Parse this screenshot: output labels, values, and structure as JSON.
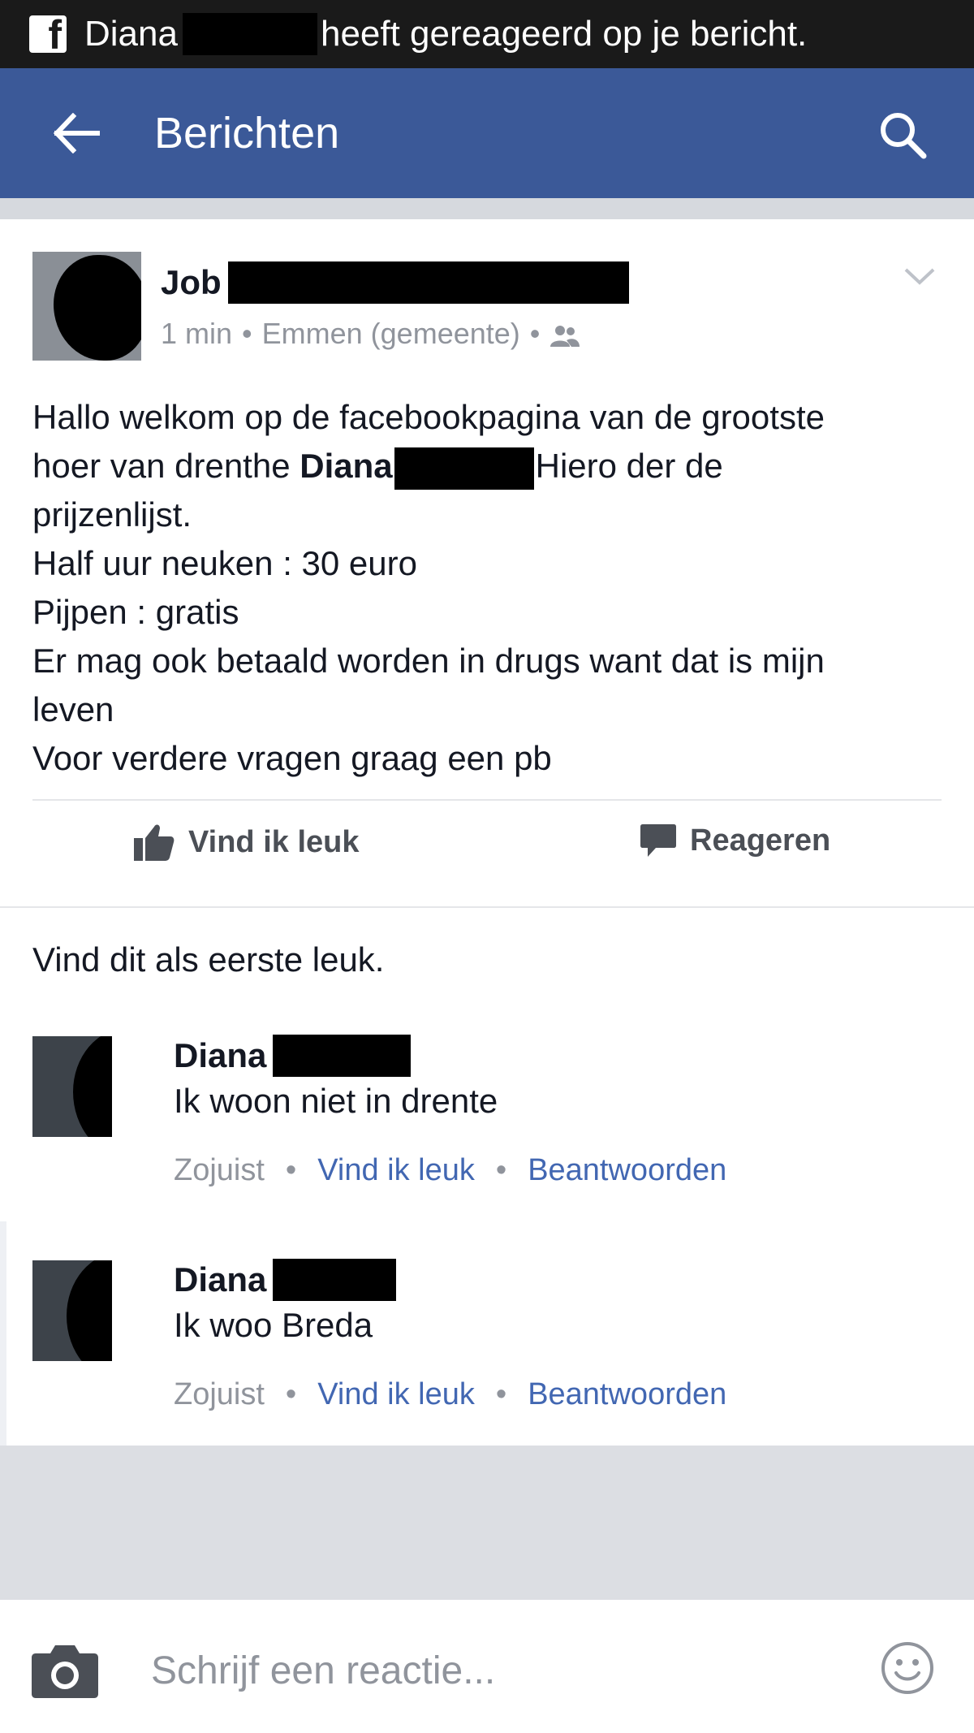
{
  "notification": {
    "app_icon": "facebook-icon",
    "name": "Diana",
    "text": "heeft gereageerd op je bericht."
  },
  "appbar": {
    "back_icon": "arrow-left-icon",
    "title": "Berichten",
    "search_icon": "search-icon"
  },
  "post": {
    "author": "Job",
    "time": "1 min",
    "location": "Emmen (gemeente)",
    "audience_icon": "friends-icon",
    "options_icon": "chevron-down-icon",
    "body": {
      "line1": "Hallo welkom op de facebookpagina van de grootste",
      "line2_before": "hoer van drenthe",
      "line2_name": "Diana",
      "line2_after": "Hiero der de",
      "line3": "prijzenlijst.",
      "line4": "Half uur neuken : 30 euro",
      "line5": "Pijpen : gratis",
      "line6": "Er mag ook betaald worden in drugs want dat is mijn",
      "line7": "leven",
      "line8": "Voor verdere vragen graag een pb"
    },
    "actions": {
      "like_label": "Vind ik leuk",
      "comment_label": "Reageren"
    }
  },
  "likes_summary": "Vind dit als eerste leuk.",
  "comments": [
    {
      "name": "Diana",
      "text": "Ik woon niet in drente",
      "time": "Zojuist",
      "like_label": "Vind ik leuk",
      "reply_label": "Beantwoorden"
    },
    {
      "name": "Diana",
      "text": "Ik woo Breda",
      "time": "Zojuist",
      "like_label": "Vind ik leuk",
      "reply_label": "Beantwoorden"
    }
  ],
  "composer": {
    "placeholder": "Schrijf een reactie...",
    "camera_icon": "camera-icon",
    "emoji_icon": "smiley-icon"
  },
  "colors": {
    "brand_blue": "#3b5998",
    "link_blue": "#4267b2",
    "meta_gray": "#90949c"
  }
}
